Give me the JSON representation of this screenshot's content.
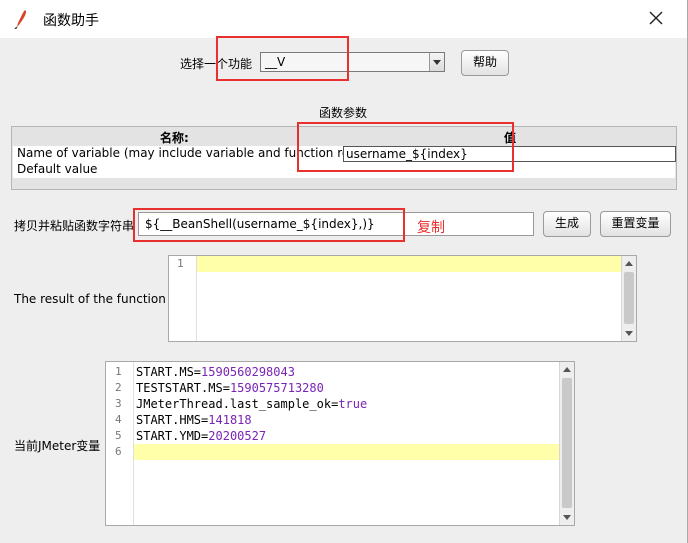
{
  "window": {
    "title": "函数助手"
  },
  "selector": {
    "label": "选择一个功能",
    "value": "__V",
    "help_button": "帮助"
  },
  "params": {
    "section_title": "函数参数",
    "col_name": "名称:",
    "col_value": "值",
    "rows": [
      {
        "name": "Name of variable (may include variable and function refer...",
        "value": "username_${index}"
      },
      {
        "name": "Default value",
        "value": ""
      }
    ]
  },
  "copy": {
    "label": "拷贝并粘贴函数字符串",
    "value": "${__BeanShell(username_${index},)}",
    "annotation": "复制",
    "generate_button": "生成",
    "reset_button": "重置变量"
  },
  "result": {
    "label": "The result of the function is",
    "lines": [
      "1"
    ]
  },
  "vars": {
    "label": "当前JMeter变量",
    "lines": [
      {
        "num": "1",
        "key": "START.MS",
        "val": "1590560298043"
      },
      {
        "num": "2",
        "key": "TESTSTART.MS",
        "val": "1590575713280"
      },
      {
        "num": "3",
        "key": "JMeterThread.last_sample_ok",
        "val": "true"
      },
      {
        "num": "4",
        "key": "START.HMS",
        "val": "141818"
      },
      {
        "num": "5",
        "key": "START.YMD",
        "val": "20200527"
      },
      {
        "num": "6",
        "key": "",
        "val": ""
      }
    ]
  },
  "colors": {
    "annotation_red": "#e8312f",
    "highlight": "#ffffaa",
    "value_purple": "#7a23b5"
  }
}
